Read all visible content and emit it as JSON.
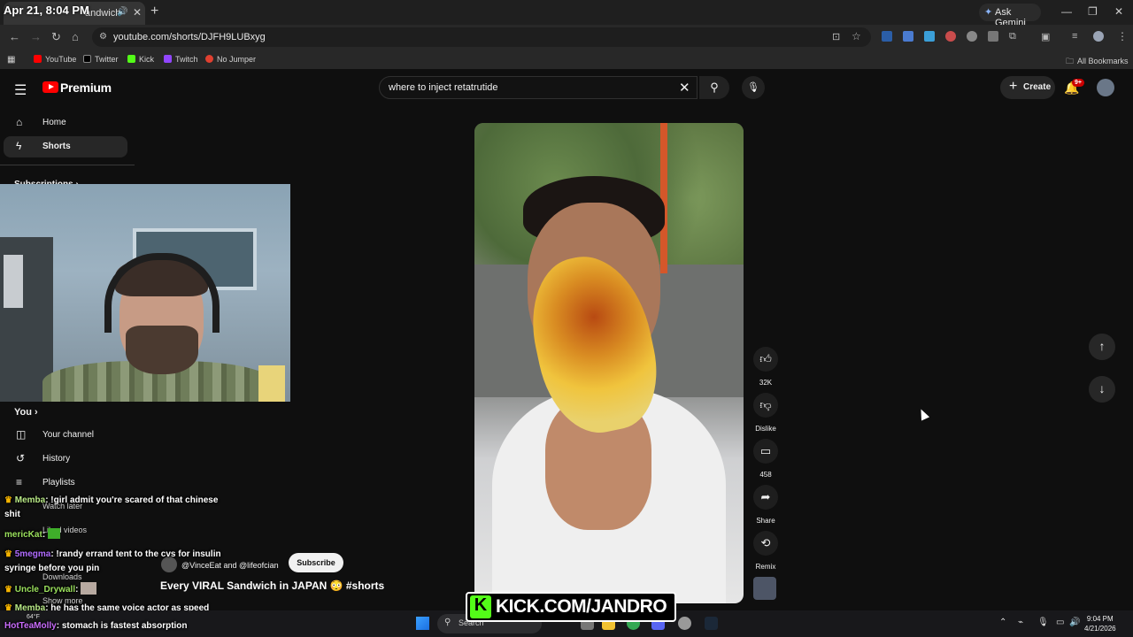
{
  "browser": {
    "tab_title": "andwich",
    "overlay_time": "Apr 21, 8:04 PM",
    "ask_gemini": "Ask Gemini",
    "url": "youtube.com/shorts/DJFH9LUBxyg",
    "bookmarks": [
      "YouTube",
      "Twitter",
      "Kick",
      "Twitch",
      "No Jumper"
    ],
    "all_bookmarks": "All Bookmarks"
  },
  "youtube": {
    "brand": "Premium",
    "search_value": "where to inject retatrutide",
    "create_label": "Create",
    "notification_count": "9+",
    "sidebar": {
      "home": "Home",
      "shorts": "Shorts",
      "subscriptions": "Subscriptions",
      "you": "You",
      "your_channel": "Your channel",
      "history": "History",
      "playlists": "Playlists",
      "watch_later": "Watch later",
      "liked_videos": "Liked videos",
      "downloads": "Downloads",
      "show_more": "Show more"
    },
    "short": {
      "likes": "32K",
      "dislike_label": "Dislike",
      "comments": "458",
      "share_label": "Share",
      "remix_label": "Remix",
      "channel": "@VinceEat and @lifeofcian",
      "subscribe_label": "Subscribe",
      "title": "Every VIRAL Sandwich in JAPAN 😳 #shorts"
    }
  },
  "chat": [
    {
      "user": "Memba",
      "text": ": !girl admit you're scared of that chinese"
    },
    {
      "user": "",
      "text": "shit"
    },
    {
      "user": "mericKat",
      "text": ":"
    },
    {
      "user": "5megma",
      "text": ": !randy errand tent to the cvs for insulin"
    },
    {
      "user": "",
      "text": "syringe before you pin"
    },
    {
      "user": "Uncle_Drywall",
      "text": ":"
    },
    {
      "user": "Memba",
      "text": ": he has the same voice actor as speed"
    },
    {
      "user": "HotTeaMolly",
      "text": ": stomach is fastest absorption"
    }
  ],
  "kick_watermark": "KICK.COM/JANDRO",
  "taskbar": {
    "search_placeholder": "Search",
    "weather": "64°F",
    "time": "9:04 PM",
    "date": "4/21/2026"
  }
}
